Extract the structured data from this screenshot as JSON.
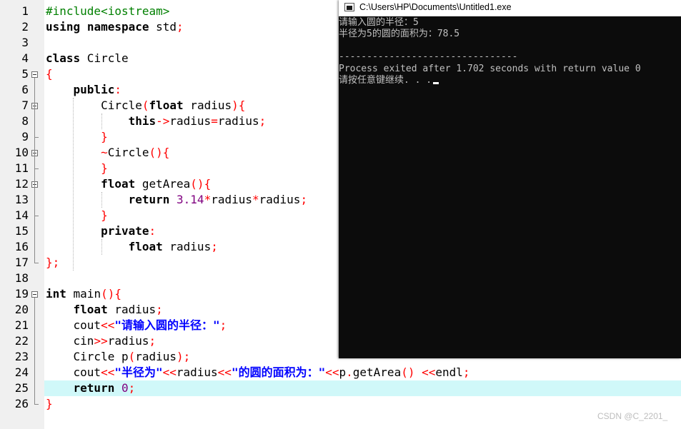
{
  "editor": {
    "line_numbers": [
      "1",
      "2",
      "3",
      "4",
      "5",
      "6",
      "7",
      "8",
      "9",
      "10",
      "11",
      "12",
      "13",
      "14",
      "15",
      "16",
      "17",
      "18",
      "19",
      "20",
      "21",
      "22",
      "23",
      "24",
      "25",
      "26"
    ],
    "active_line": "25",
    "code": [
      [
        [
          "pp",
          "#include<iostream>"
        ]
      ],
      [
        [
          "kw",
          "using"
        ],
        [
          "n",
          " "
        ],
        [
          "kw",
          "namespace"
        ],
        [
          "n",
          " std"
        ],
        [
          "sym",
          ";"
        ]
      ],
      [],
      [
        [
          "kw",
          "class"
        ],
        [
          "n",
          " Circle"
        ]
      ],
      [
        [
          "sym",
          "{"
        ]
      ],
      [
        [
          "n",
          "    "
        ],
        [
          "kw",
          "public"
        ],
        [
          "sym",
          ":"
        ]
      ],
      [
        [
          "n",
          "        Circle"
        ],
        [
          "sym",
          "("
        ],
        [
          "kw",
          "float"
        ],
        [
          "n",
          " radius"
        ],
        [
          "sym",
          "){"
        ]
      ],
      [
        [
          "n",
          "            "
        ],
        [
          "kw",
          "this"
        ],
        [
          "sym",
          "->"
        ],
        [
          "n",
          "radius"
        ],
        [
          "sym",
          "="
        ],
        [
          "n",
          "radius"
        ],
        [
          "sym",
          ";"
        ]
      ],
      [
        [
          "n",
          "        "
        ],
        [
          "sym",
          "}"
        ]
      ],
      [
        [
          "n",
          "        "
        ],
        [
          "sym",
          "~"
        ],
        [
          "n",
          "Circle"
        ],
        [
          "sym",
          "(){"
        ]
      ],
      [
        [
          "n",
          "        "
        ],
        [
          "sym",
          "}"
        ]
      ],
      [
        [
          "n",
          "        "
        ],
        [
          "kw",
          "float"
        ],
        [
          "n",
          " getArea"
        ],
        [
          "sym",
          "(){"
        ]
      ],
      [
        [
          "n",
          "            "
        ],
        [
          "kw",
          "return"
        ],
        [
          "n",
          " "
        ],
        [
          "num",
          "3.14"
        ],
        [
          "sym",
          "*"
        ],
        [
          "n",
          "radius"
        ],
        [
          "sym",
          "*"
        ],
        [
          "n",
          "radius"
        ],
        [
          "sym",
          ";"
        ]
      ],
      [
        [
          "n",
          "        "
        ],
        [
          "sym",
          "}"
        ]
      ],
      [
        [
          "n",
          "        "
        ],
        [
          "kw",
          "private"
        ],
        [
          "sym",
          ":"
        ]
      ],
      [
        [
          "n",
          "            "
        ],
        [
          "kw",
          "float"
        ],
        [
          "n",
          " radius"
        ],
        [
          "sym",
          ";"
        ]
      ],
      [
        [
          "sym",
          "};"
        ]
      ],
      [],
      [
        [
          "kw",
          "int"
        ],
        [
          "n",
          " main"
        ],
        [
          "sym",
          "(){"
        ]
      ],
      [
        [
          "n",
          "    "
        ],
        [
          "kw",
          "float"
        ],
        [
          "n",
          " radius"
        ],
        [
          "sym",
          ";"
        ]
      ],
      [
        [
          "n",
          "    cout"
        ],
        [
          "sym",
          "<<"
        ],
        [
          "str",
          "\"请输入圆的半径：\""
        ],
        [
          "sym",
          ";"
        ]
      ],
      [
        [
          "n",
          "    cin"
        ],
        [
          "sym",
          ">>"
        ],
        [
          "n",
          "radius"
        ],
        [
          "sym",
          ";"
        ]
      ],
      [
        [
          "n",
          "    Circle p"
        ],
        [
          "sym",
          "("
        ],
        [
          "n",
          "radius"
        ],
        [
          "sym",
          ");"
        ]
      ],
      [
        [
          "n",
          "    cout"
        ],
        [
          "sym",
          "<<"
        ],
        [
          "str",
          "\"半径为\""
        ],
        [
          "sym",
          "<<"
        ],
        [
          "n",
          "radius"
        ],
        [
          "sym",
          "<<"
        ],
        [
          "str",
          "\"的圆的面积为：\""
        ],
        [
          "sym",
          "<<"
        ],
        [
          "n",
          "p"
        ],
        [
          "sym",
          "."
        ],
        [
          "n",
          "getArea"
        ],
        [
          "sym",
          "()"
        ],
        [
          "n",
          " "
        ],
        [
          "sym",
          "<<"
        ],
        [
          "n",
          "endl"
        ],
        [
          "sym",
          ";"
        ]
      ],
      [
        [
          "n",
          "    "
        ],
        [
          "kw",
          "return"
        ],
        [
          "n",
          " "
        ],
        [
          "num",
          "0"
        ],
        [
          "sym",
          ";"
        ]
      ],
      [
        [
          "sym",
          "}"
        ]
      ]
    ]
  },
  "console": {
    "title": "C:\\Users\\HP\\Documents\\Untitled1.exe",
    "icon": "console-app-icon",
    "lines": [
      "请输入圆的半径：5",
      "半径为5的圆的面积为：78.5",
      "",
      "--------------------------------",
      "Process exited after 1.702 seconds with return value 0",
      "请按任意键继续. . ."
    ]
  },
  "watermark": "CSDN @C_2201_",
  "colors": {
    "keyword": "#000000",
    "preprocessor": "#008000",
    "symbol": "#ff0000",
    "number": "#800080",
    "string": "#0000ff",
    "active_line_bg": "#d0f8f9",
    "gutter_bg": "#f0f0f0",
    "console_bg": "#0c0c0c",
    "console_text": "#c0c0c0"
  }
}
